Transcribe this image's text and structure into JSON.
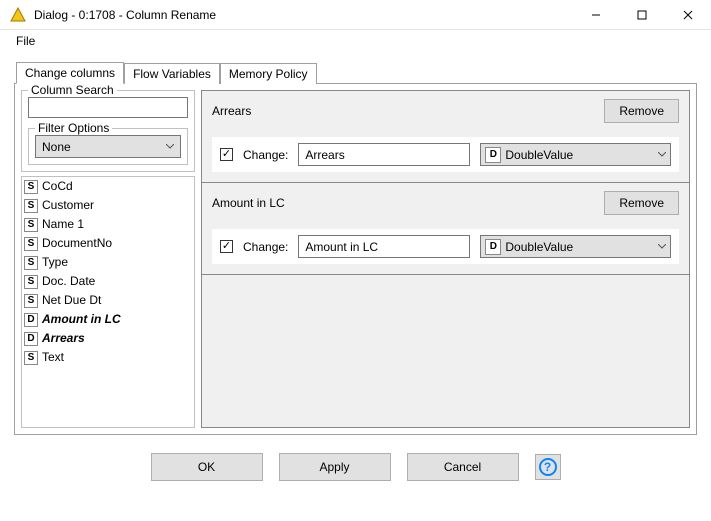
{
  "window": {
    "title": "Dialog - 0:1708 - Column Rename"
  },
  "menu": {
    "file": "File"
  },
  "tabs": [
    {
      "label": "Change columns"
    },
    {
      "label": "Flow Variables"
    },
    {
      "label": "Memory Policy"
    }
  ],
  "left": {
    "search_legend": "Column Search",
    "search_value": "",
    "filter_legend": "Filter Options",
    "filter_selected": "None",
    "columns": [
      {
        "type": "S",
        "label": "CoCd",
        "changed": false
      },
      {
        "type": "S",
        "label": "Customer",
        "changed": false
      },
      {
        "type": "S",
        "label": "Name 1",
        "changed": false
      },
      {
        "type": "S",
        "label": "DocumentNo",
        "changed": false
      },
      {
        "type": "S",
        "label": "Type",
        "changed": false
      },
      {
        "type": "S",
        "label": "Doc. Date",
        "changed": false
      },
      {
        "type": "S",
        "label": "Net Due Dt",
        "changed": false
      },
      {
        "type": "D",
        "label": "Amount in LC",
        "changed": true
      },
      {
        "type": "D",
        "label": "Arrears",
        "changed": true
      },
      {
        "type": "S",
        "label": "Text",
        "changed": false
      }
    ]
  },
  "right": {
    "change_label": "Change:",
    "remove_label": "Remove",
    "blocks": [
      {
        "orig": "Arrears",
        "checked": true,
        "newname": "Arrears",
        "type_badge": "D",
        "type_label": "DoubleValue"
      },
      {
        "orig": "Amount in LC",
        "checked": true,
        "newname": "Amount in LC",
        "type_badge": "D",
        "type_label": "DoubleValue"
      }
    ]
  },
  "buttons": {
    "ok": "OK",
    "apply": "Apply",
    "cancel": "Cancel",
    "help_glyph": "?"
  }
}
